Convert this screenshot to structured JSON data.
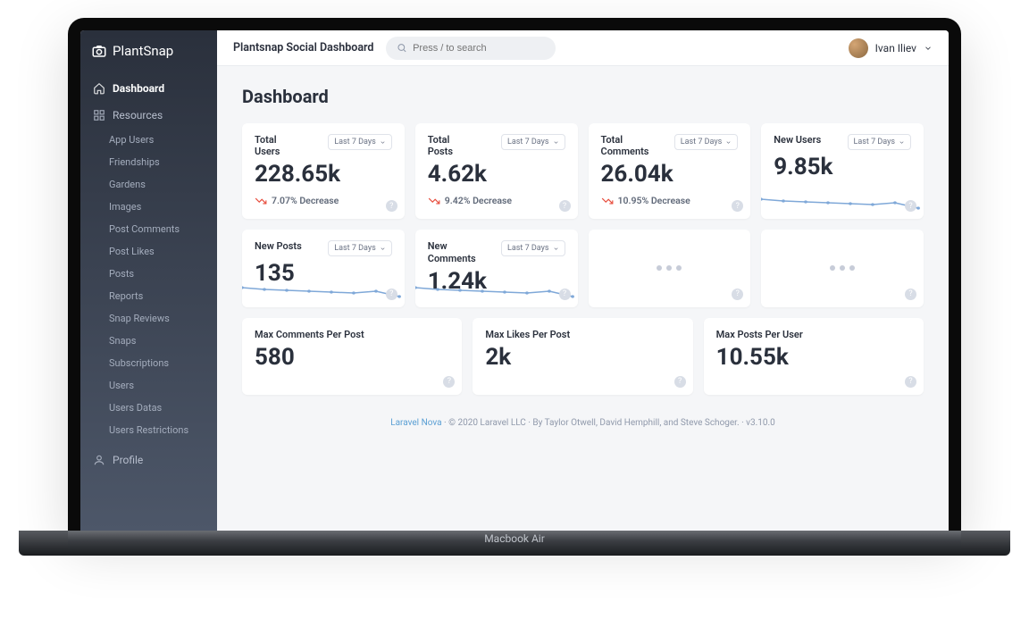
{
  "brand": "PlantSnap",
  "breadcrumb": "Plantsnap Social Dashboard",
  "search": {
    "placeholder": "Press / to search"
  },
  "user": {
    "name": "Ivan Iliev"
  },
  "sidebar": {
    "dashboard": "Dashboard",
    "resources": "Resources",
    "profile": "Profile",
    "items": [
      "App Users",
      "Friendships",
      "Gardens",
      "Images",
      "Post Comments",
      "Post Likes",
      "Posts",
      "Reports",
      "Snap Reviews",
      "Snaps",
      "Subscriptions",
      "Users",
      "Users Datas",
      "Users Restrictions"
    ]
  },
  "page": {
    "title": "Dashboard"
  },
  "range_label": "Last 7 Days",
  "kpis_row1": [
    {
      "title": "Total Users",
      "value": "228.65k",
      "trend": "7.07% Decrease",
      "direction": "down",
      "spark": false
    },
    {
      "title": "Total Posts",
      "value": "4.62k",
      "trend": "9.42% Decrease",
      "direction": "down",
      "spark": false
    },
    {
      "title": "Total Comments",
      "value": "26.04k",
      "trend": "10.95% Decrease",
      "direction": "down",
      "spark": false
    },
    {
      "title": "New Users",
      "value": "9.85k",
      "trend": null,
      "spark": true
    }
  ],
  "kpis_row2": [
    {
      "title": "New Posts",
      "value": "135",
      "spark": true
    },
    {
      "title": "New Comments",
      "value": "1.24k",
      "spark": true
    },
    {
      "loading": true
    },
    {
      "loading": true
    }
  ],
  "stats_row3": [
    {
      "title": "Max Comments Per Post",
      "value": "580"
    },
    {
      "title": "Max Likes Per Post",
      "value": "2k"
    },
    {
      "title": "Max Posts Per User",
      "value": "10.55k"
    }
  ],
  "footer": {
    "link": "Laravel Nova",
    "text": " · © 2020 Laravel LLC · By Taylor Otwell, David Hemphill, and Steve Schoger. · v3.10.0"
  },
  "chart_data": [
    {
      "type": "line",
      "title": "New Users",
      "period": "Last 7 Days",
      "x": [
        1,
        2,
        3,
        4,
        5,
        6,
        7,
        8
      ],
      "y": [
        1450,
        1420,
        1410,
        1400,
        1390,
        1380,
        1395,
        1380
      ],
      "ylim": [
        1300,
        1500
      ]
    },
    {
      "type": "line",
      "title": "New Posts",
      "period": "Last 7 Days",
      "x": [
        1,
        2,
        3,
        4,
        5,
        6,
        7,
        8
      ],
      "y": [
        21,
        18,
        19,
        18,
        20,
        17,
        20,
        18
      ],
      "ylim": [
        10,
        25
      ]
    },
    {
      "type": "line",
      "title": "New Comments",
      "period": "Last 7 Days",
      "x": [
        1,
        2,
        3,
        4,
        5,
        6,
        7,
        8
      ],
      "y": [
        200,
        185,
        175,
        172,
        170,
        165,
        172,
        165
      ],
      "ylim": [
        130,
        210
      ]
    }
  ],
  "device_label": "Macbook Air"
}
